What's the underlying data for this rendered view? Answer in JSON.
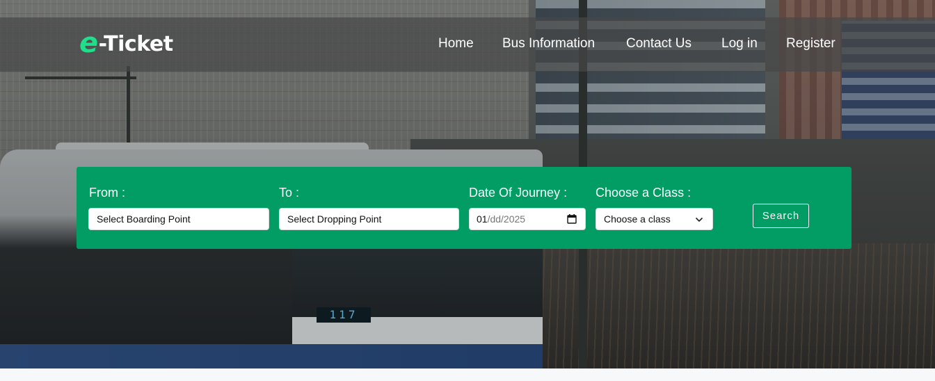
{
  "brand": {
    "prefix": "e",
    "name": "-Ticket"
  },
  "nav": {
    "items": [
      {
        "label": "Home"
      },
      {
        "label": "Bus Information"
      },
      {
        "label": "Contact Us"
      },
      {
        "label": "Log in"
      },
      {
        "label": "Register"
      }
    ]
  },
  "hero": {
    "bus_destination_sign": "117",
    "search": {
      "from": {
        "label": "From :",
        "placeholder": "Select Boarding Point"
      },
      "to": {
        "label": "To :",
        "placeholder": "Select Dropping Point"
      },
      "date": {
        "label": "Date Of Journey :",
        "value_month": "01",
        "value_rest": "/dd/2025"
      },
      "class": {
        "label": "Choose a Class :",
        "selected": "Choose a class"
      },
      "button_label": "Search"
    }
  },
  "colors": {
    "panel": "#019d64",
    "brand_accent": "#1fdf8a",
    "navbar": "rgba(70,72,72,0.72)"
  }
}
